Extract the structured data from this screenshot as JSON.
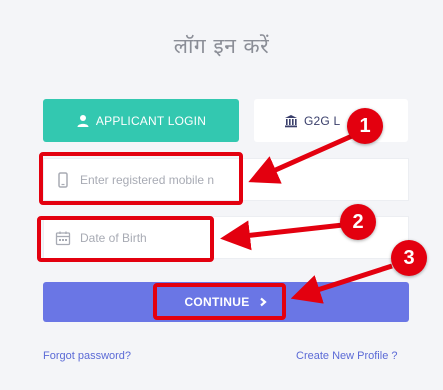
{
  "page": {
    "title": "लॉग इन करें"
  },
  "tabs": {
    "applicant": {
      "label": "APPLICANT LOGIN",
      "icon": "user-icon"
    },
    "g2g": {
      "label": "G2G L",
      "icon": "bank-icon"
    }
  },
  "form": {
    "mobile": {
      "placeholder": "Enter registered mobile n",
      "icon": "mobile-phone-icon"
    },
    "dob": {
      "placeholder": "Date of Birth",
      "icon": "calendar-icon"
    },
    "continue_label": "CONTINUE"
  },
  "links": {
    "forgot": "Forgot password?",
    "create": "Create New Profile ?"
  },
  "annotations": {
    "badges": [
      "1",
      "2",
      "3"
    ],
    "color": "#e3000f"
  },
  "colors": {
    "applicant_tab": "#33c8b0",
    "continue_button": "#6a76e5",
    "link": "#5b6ad6"
  }
}
